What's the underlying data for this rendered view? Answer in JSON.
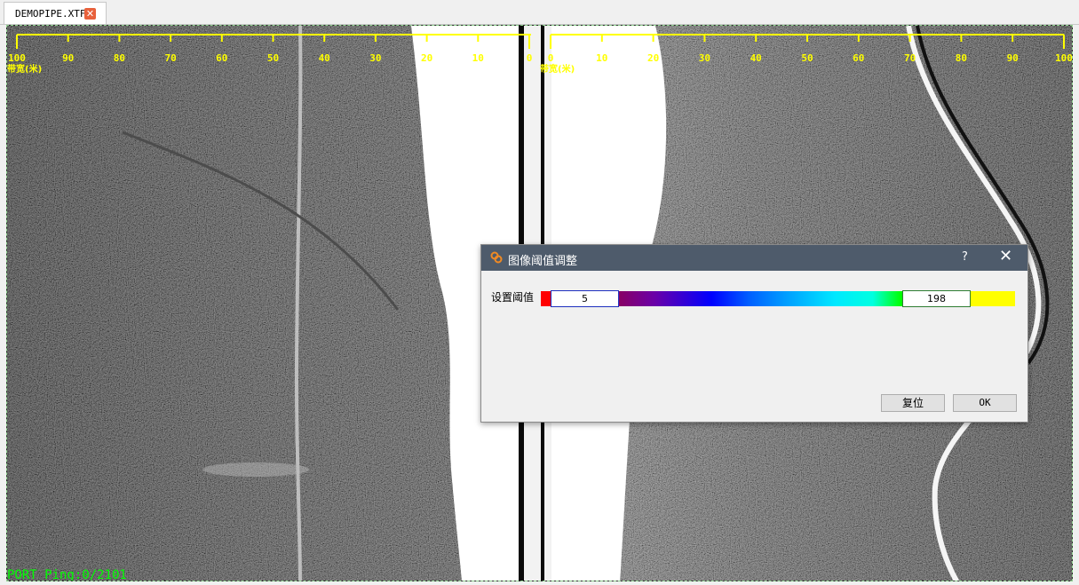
{
  "tab": {
    "filename": "DEMOPIPE.XTF"
  },
  "scale": {
    "left_ticks": [
      "100",
      "90",
      "80",
      "70",
      "60",
      "50",
      "40",
      "30",
      "20",
      "10",
      "0"
    ],
    "right_ticks": [
      "0",
      "10",
      "20",
      "30",
      "40",
      "50",
      "60",
      "70",
      "80",
      "90",
      "100"
    ],
    "unit_label": "带宽(米)"
  },
  "status": {
    "text": "PORT Ping:0/2101"
  },
  "dialog": {
    "title": "图像阈值调整",
    "help_symbol": "?",
    "close_symbol": "✕",
    "threshold_label": "设置阈值",
    "threshold_min": "5",
    "threshold_max": "198",
    "reset_label": "复位",
    "ok_label": "OK"
  },
  "colors": {
    "scale": "#ffff00",
    "status": "#00ff00",
    "dialog_title_bg": "#4e5b6b"
  }
}
